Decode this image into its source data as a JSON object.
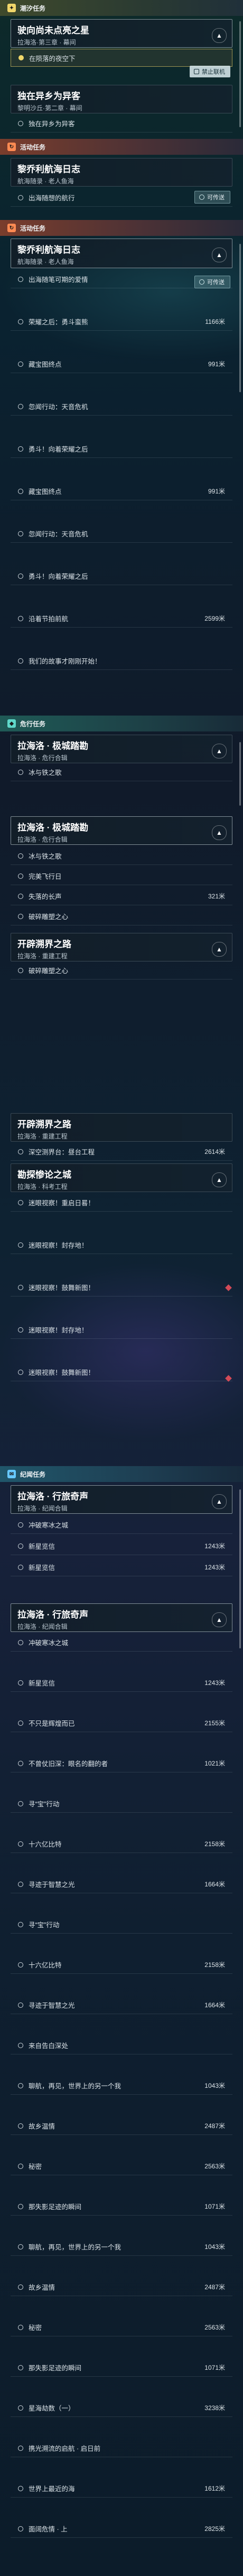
{
  "sections": {
    "main": "潮汐任务",
    "event1": "活动任务",
    "event2": "活动任务",
    "hangout": "危行任务",
    "lore": "纪闻任务"
  },
  "buttons": {
    "disable_join": "禁止联机",
    "teleport": "可传送"
  },
  "quests": {
    "q1": {
      "title": "驶向尚未点亮之星",
      "sub": "拉海洛·第三章 · 幕间",
      "steps": [
        "在陨落的夜空下"
      ]
    },
    "q2": {
      "title": "独在异乡为异客",
      "sub": "黎明沙丘·第二章 · 幕间",
      "steps": [
        "独在异乡为异客"
      ]
    },
    "q3": {
      "title": "黎乔利航海日志",
      "sub": "航海随录 · 老人鱼海",
      "steps": [
        "出海随想的航行",
        "出海随想的航行"
      ]
    },
    "q4": {
      "title": "黎乔利航海日志",
      "sub": "航海随录 · 老人鱼海",
      "steps": [
        {
          "text": "出海随笔可期的爱情",
          "dist": ""
        },
        {
          "text": "荣耀之后：勇斗蛮熊",
          "dist": "1166米"
        },
        {
          "text": "藏宝图终点",
          "dist": "991米"
        },
        {
          "text": "忽闻行动：天音危机",
          "dist": ""
        },
        {
          "text": "勇斗！向着荣耀之后",
          "dist": ""
        },
        {
          "text": "藏宝图终点",
          "dist": "991米"
        },
        {
          "text": "忽闻行动：天音危机",
          "dist": ""
        },
        {
          "text": "勇斗！向着荣耀之后",
          "dist": ""
        },
        {
          "text": "沿着节拍前航",
          "dist": "2599米"
        },
        {
          "text": "我们的故事才刚刚开始！",
          "dist": ""
        }
      ]
    },
    "q5": {
      "title": "拉海洛 · 极城踏勘",
      "sub": "拉海洛 · 危行合辑",
      "steps": [
        {
          "text": "冰与铁之歌",
          "dist": ""
        }
      ]
    },
    "q6": {
      "title": "拉海洛 · 极城踏勘",
      "sub": "拉海洛 · 危行合辑",
      "steps": [
        {
          "text": "冰与铁之歌",
          "dist": ""
        },
        {
          "text": "完美飞行日",
          "dist": ""
        },
        {
          "text": "失落的长声",
          "dist": "321米"
        },
        {
          "text": "破碎雕塑之心",
          "dist": ""
        }
      ]
    },
    "q7": {
      "title": "开辟溯界之路",
      "sub": "拉海洛 · 重建工程",
      "steps": [
        {
          "text": "破碎雕塑之心",
          "dist": ""
        }
      ]
    },
    "q8": {
      "title": "开辟溯界之路",
      "sub": "拉海洛 · 重建工程",
      "steps": [
        {
          "text": "深空测界台：昼台工程",
          "dist": "2614米"
        }
      ]
    },
    "q9": {
      "title": "勘探惨论之城",
      "sub": "拉海洛 · 科考工程",
      "steps": [
        {
          "text": "迷眼视察！重启日晷！",
          "dist": ""
        },
        {
          "text": "迷眼视察！封存地！",
          "dist": ""
        },
        {
          "text": "迷眼视察！鼓舞新图！",
          "dist": ""
        },
        {
          "text": "迷眼视察！封存地！",
          "dist": ""
        },
        {
          "text": "迷眼视察！鼓舞新图！",
          "dist": ""
        }
      ]
    },
    "q10": {
      "title": "拉海洛 · 行旅奇声",
      "sub": "拉海洛 · 纪闻合辑",
      "steps": [
        {
          "text": "冲破寒冰之城",
          "dist": ""
        },
        {
          "text": "新星览信",
          "dist": "1243米"
        },
        {
          "text": "新星览信",
          "dist": "1243米"
        }
      ]
    },
    "q11": {
      "title": "拉海洛 · 行旅奇声",
      "sub": "拉海洛 · 纪闻合辑",
      "steps": [
        {
          "text": "冲破寒冰之城",
          "dist": ""
        },
        {
          "text": "新星览信",
          "dist": "1243米"
        },
        {
          "text": "不只是辉煌而已",
          "dist": "2155米"
        },
        {
          "text": "不曾仗旧深：眼名的翻的者",
          "dist": "1021米"
        },
        {
          "text": "寻“宝”行动",
          "dist": ""
        },
        {
          "text": "十六亿比特",
          "dist": "2158米"
        },
        {
          "text": "寻迹于智慧之光",
          "dist": "1664米"
        },
        {
          "text": "寻“宝”行动",
          "dist": ""
        },
        {
          "text": "十六亿比特",
          "dist": "2158米"
        },
        {
          "text": "寻迹于智慧之光",
          "dist": "1664米"
        },
        {
          "text": "来自告白深处",
          "dist": ""
        },
        {
          "text": "聊航，再见，世界上的另一个我",
          "dist": "1043米"
        },
        {
          "text": "故乡温情",
          "dist": "2487米"
        },
        {
          "text": "秘密",
          "dist": "2563米"
        },
        {
          "text": "那失影足迹的瞬间",
          "dist": "1071米"
        },
        {
          "text": "聊航，再见，世界上的另一个我",
          "dist": "1043米"
        },
        {
          "text": "故乡温情",
          "dist": "2487米"
        },
        {
          "text": "秘密",
          "dist": "2563米"
        },
        {
          "text": "那失影足迹的瞬间",
          "dist": "1071米"
        },
        {
          "text": "星海劫数（一）",
          "dist": "3238米"
        },
        {
          "text": "携光溯流的启航 · 启日前",
          "dist": ""
        },
        {
          "text": "世界上最近的海",
          "dist": "1612米"
        },
        {
          "text": "面阔危情 · 上",
          "dist": "2825米"
        }
      ]
    }
  }
}
